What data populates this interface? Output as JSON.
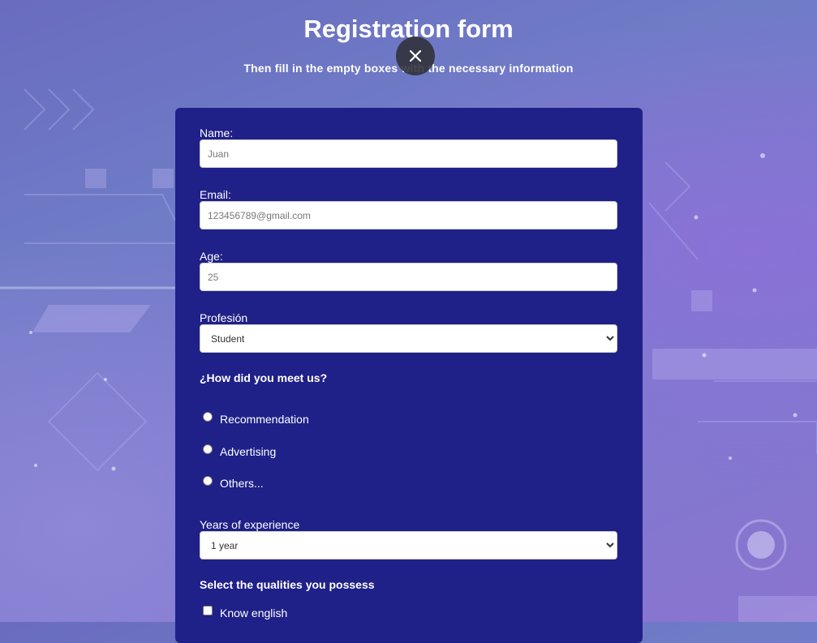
{
  "header": {
    "title": "Registration form",
    "subtitle": "Then fill in the empty boxes with the necessary information"
  },
  "form": {
    "name": {
      "label": "Name:",
      "placeholder": "Juan"
    },
    "email": {
      "label": "Email:",
      "placeholder": "123456789@gmail.com"
    },
    "age": {
      "label": "Age:",
      "placeholder": "25"
    },
    "profession": {
      "label": "Profesión",
      "selected": "Student"
    },
    "how_met": {
      "heading": "¿How did you meet us?",
      "options": [
        "Recommendation",
        "Advertising",
        "Others..."
      ]
    },
    "experience": {
      "label": "Years of experience",
      "selected": "1 year"
    },
    "qualities": {
      "heading": "Select the qualities you possess",
      "options": [
        "Know english"
      ]
    }
  },
  "icons": {
    "close": "close-icon"
  },
  "colors": {
    "card": "#1f2088",
    "close_button": "#303038"
  }
}
